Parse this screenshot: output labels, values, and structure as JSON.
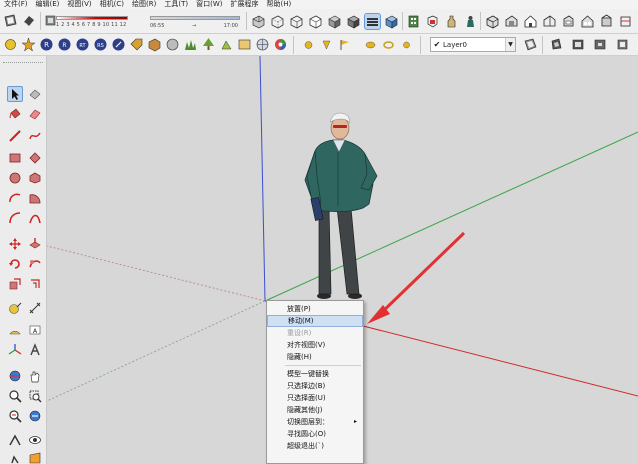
{
  "menu": [
    "文件(F)",
    "编辑(E)",
    "视图(V)",
    "相机(C)",
    "绘图(R)",
    "工具(T)",
    "窗口(W)",
    "扩展程序",
    "帮助(H)"
  ],
  "shadow": {
    "scale_labels": "1 2 3 4 5 6 7 8 9 10 11 12",
    "time_start": "06:55",
    "time_end": "17:00",
    "time_indicator": "→"
  },
  "layer": {
    "check": "✔",
    "value": "Layer0",
    "arrow": "▼"
  },
  "context_menu": {
    "items": [
      {
        "label": "放置(P)",
        "state": "normal"
      },
      {
        "label": "移动(M)",
        "state": "highlighted"
      },
      {
        "label": "重设(R)",
        "state": "disabled"
      },
      {
        "label": "对齐视图(V)",
        "state": "normal"
      },
      {
        "label": "隐藏(H)",
        "state": "normal"
      },
      {
        "sep": true
      },
      {
        "label": "模型一键替换",
        "state": "normal"
      },
      {
        "label": "只选择边(B)",
        "state": "normal"
      },
      {
        "label": "只选择面(U)",
        "state": "normal"
      },
      {
        "label": "隐藏其他(J)",
        "state": "normal"
      },
      {
        "label": "切换图层到：",
        "state": "normal",
        "submenu": "▸"
      },
      {
        "label": "寻找圆心(O)",
        "state": "normal"
      },
      {
        "label": "超级退出(`)",
        "state": "normal"
      }
    ]
  },
  "colors": {
    "axis_blue": "#3a4fd0",
    "axis_green": "#3aa64a",
    "axis_red": "#d02a2a",
    "arrow_red": "#e33030",
    "highlight": "#cfe0f5"
  }
}
